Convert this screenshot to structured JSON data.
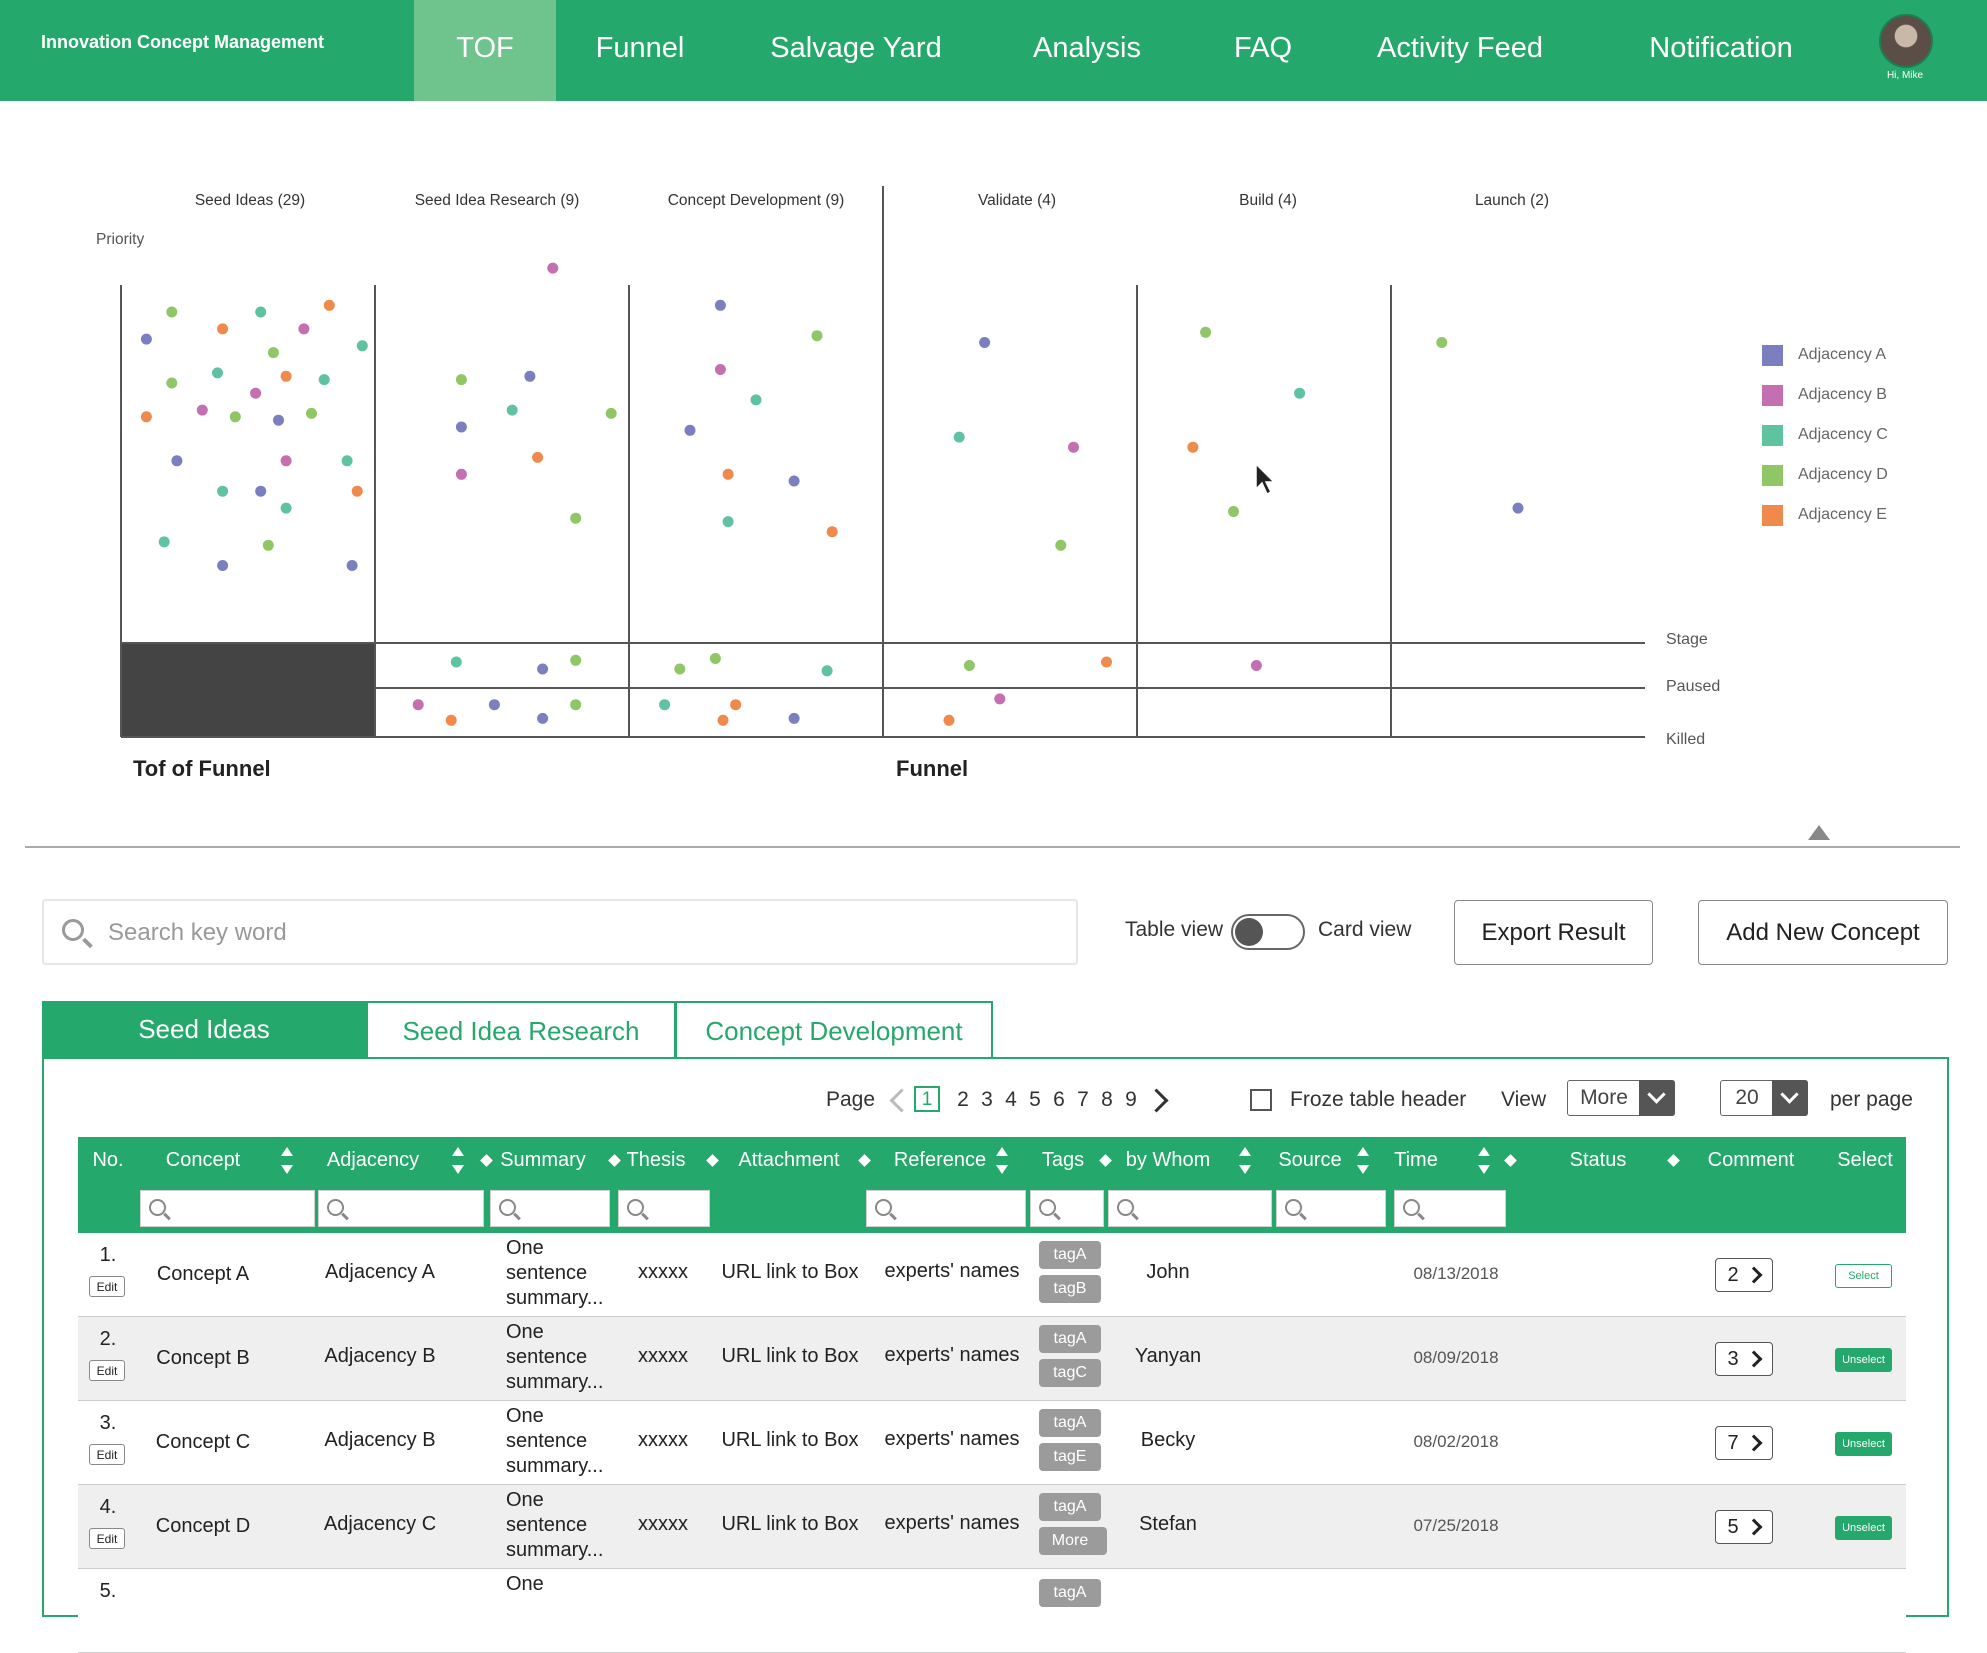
{
  "app": {
    "title": "Innovation Concept Management",
    "greeting": "Hi, Mike",
    "nav": [
      "TOF",
      "Funnel",
      "Salvage Yard",
      "Analysis",
      "FAQ",
      "Activity Feed",
      "Notification"
    ],
    "active_nav": "TOF"
  },
  "chart_data": {
    "type": "scatter",
    "y_axis_label": "Priority",
    "columns": [
      "Seed Ideas (29)",
      "Seed Idea Research (9)",
      "Concept Development (9)",
      "Validate (4)",
      "Build (4)",
      "Launch (2)"
    ],
    "row_labels": [
      "Stage",
      "Paused",
      "Killed"
    ],
    "section_labels": [
      "Tof of Funnel",
      "Funnel"
    ],
    "legend": [
      {
        "name": "Adjacency A",
        "color": "#7b7fbf"
      },
      {
        "name": "Adjacency B",
        "color": "#c46fb0"
      },
      {
        "name": "Adjacency C",
        "color": "#5fc3a0"
      },
      {
        "name": "Adjacency D",
        "color": "#8fc766"
      },
      {
        "name": "Adjacency E",
        "color": "#f0894c"
      }
    ],
    "points_note_units": "col = stage column index; pos = position within column 0-1; priority = 0 (low) to 1 (high); row = stage|paused|killed",
    "points": [
      {
        "col": 0,
        "pos": 0.2,
        "priority": 0.92,
        "adj": "D",
        "row": "stage"
      },
      {
        "col": 0,
        "pos": 0.55,
        "priority": 0.92,
        "adj": "C",
        "row": "stage"
      },
      {
        "col": 0,
        "pos": 0.82,
        "priority": 0.94,
        "adj": "E",
        "row": "stage"
      },
      {
        "col": 0,
        "pos": 0.1,
        "priority": 0.84,
        "adj": "A",
        "row": "stage"
      },
      {
        "col": 0,
        "pos": 0.4,
        "priority": 0.87,
        "adj": "E",
        "row": "stage"
      },
      {
        "col": 0,
        "pos": 0.72,
        "priority": 0.87,
        "adj": "B",
        "row": "stage"
      },
      {
        "col": 0,
        "pos": 0.95,
        "priority": 0.82,
        "adj": "C",
        "row": "stage"
      },
      {
        "col": 0,
        "pos": 0.6,
        "priority": 0.8,
        "adj": "D",
        "row": "stage"
      },
      {
        "col": 0,
        "pos": 0.2,
        "priority": 0.71,
        "adj": "D",
        "row": "stage"
      },
      {
        "col": 0,
        "pos": 0.38,
        "priority": 0.74,
        "adj": "C",
        "row": "stage"
      },
      {
        "col": 0,
        "pos": 0.65,
        "priority": 0.73,
        "adj": "E",
        "row": "stage"
      },
      {
        "col": 0,
        "pos": 0.8,
        "priority": 0.72,
        "adj": "C",
        "row": "stage"
      },
      {
        "col": 0,
        "pos": 0.53,
        "priority": 0.68,
        "adj": "B",
        "row": "stage"
      },
      {
        "col": 0,
        "pos": 0.1,
        "priority": 0.61,
        "adj": "E",
        "row": "stage"
      },
      {
        "col": 0,
        "pos": 0.32,
        "priority": 0.63,
        "adj": "B",
        "row": "stage"
      },
      {
        "col": 0,
        "pos": 0.45,
        "priority": 0.61,
        "adj": "D",
        "row": "stage"
      },
      {
        "col": 0,
        "pos": 0.62,
        "priority": 0.6,
        "adj": "A",
        "row": "stage"
      },
      {
        "col": 0,
        "pos": 0.75,
        "priority": 0.62,
        "adj": "D",
        "row": "stage"
      },
      {
        "col": 0,
        "pos": 0.22,
        "priority": 0.48,
        "adj": "A",
        "row": "stage"
      },
      {
        "col": 0,
        "pos": 0.65,
        "priority": 0.48,
        "adj": "B",
        "row": "stage"
      },
      {
        "col": 0,
        "pos": 0.89,
        "priority": 0.48,
        "adj": "C",
        "row": "stage"
      },
      {
        "col": 0,
        "pos": 0.4,
        "priority": 0.39,
        "adj": "C",
        "row": "stage"
      },
      {
        "col": 0,
        "pos": 0.55,
        "priority": 0.39,
        "adj": "A",
        "row": "stage"
      },
      {
        "col": 0,
        "pos": 0.93,
        "priority": 0.39,
        "adj": "E",
        "row": "stage"
      },
      {
        "col": 0,
        "pos": 0.65,
        "priority": 0.34,
        "adj": "C",
        "row": "stage"
      },
      {
        "col": 0,
        "pos": 0.17,
        "priority": 0.24,
        "adj": "C",
        "row": "stage"
      },
      {
        "col": 0,
        "pos": 0.58,
        "priority": 0.23,
        "adj": "D",
        "row": "stage"
      },
      {
        "col": 0,
        "pos": 0.4,
        "priority": 0.17,
        "adj": "A",
        "row": "stage"
      },
      {
        "col": 0,
        "pos": 0.91,
        "priority": 0.17,
        "adj": "A",
        "row": "stage"
      },
      {
        "col": 1,
        "pos": 0.7,
        "priority": 1.05,
        "adj": "B",
        "row": "stage"
      },
      {
        "col": 1,
        "pos": 0.34,
        "priority": 0.72,
        "adj": "D",
        "row": "stage"
      },
      {
        "col": 1,
        "pos": 0.61,
        "priority": 0.73,
        "adj": "A",
        "row": "stage"
      },
      {
        "col": 1,
        "pos": 0.54,
        "priority": 0.63,
        "adj": "C",
        "row": "stage"
      },
      {
        "col": 1,
        "pos": 0.93,
        "priority": 0.62,
        "adj": "D",
        "row": "stage"
      },
      {
        "col": 1,
        "pos": 0.34,
        "priority": 0.58,
        "adj": "A",
        "row": "stage"
      },
      {
        "col": 1,
        "pos": 0.64,
        "priority": 0.49,
        "adj": "E",
        "row": "stage"
      },
      {
        "col": 1,
        "pos": 0.34,
        "priority": 0.44,
        "adj": "B",
        "row": "stage"
      },
      {
        "col": 1,
        "pos": 0.79,
        "priority": 0.31,
        "adj": "D",
        "row": "stage"
      },
      {
        "col": 2,
        "pos": 0.36,
        "priority": 0.94,
        "adj": "A",
        "row": "stage"
      },
      {
        "col": 2,
        "pos": 0.74,
        "priority": 0.85,
        "adj": "D",
        "row": "stage"
      },
      {
        "col": 2,
        "pos": 0.36,
        "priority": 0.75,
        "adj": "B",
        "row": "stage"
      },
      {
        "col": 2,
        "pos": 0.5,
        "priority": 0.66,
        "adj": "C",
        "row": "stage"
      },
      {
        "col": 2,
        "pos": 0.24,
        "priority": 0.57,
        "adj": "A",
        "row": "stage"
      },
      {
        "col": 2,
        "pos": 0.39,
        "priority": 0.44,
        "adj": "E",
        "row": "stage"
      },
      {
        "col": 2,
        "pos": 0.65,
        "priority": 0.42,
        "adj": "A",
        "row": "stage"
      },
      {
        "col": 2,
        "pos": 0.39,
        "priority": 0.3,
        "adj": "C",
        "row": "stage"
      },
      {
        "col": 2,
        "pos": 0.8,
        "priority": 0.27,
        "adj": "E",
        "row": "stage"
      },
      {
        "col": 3,
        "pos": 0.4,
        "priority": 0.83,
        "adj": "A",
        "row": "stage"
      },
      {
        "col": 3,
        "pos": 0.3,
        "priority": 0.55,
        "adj": "C",
        "row": "stage"
      },
      {
        "col": 3,
        "pos": 0.75,
        "priority": 0.52,
        "adj": "B",
        "row": "stage"
      },
      {
        "col": 3,
        "pos": 0.7,
        "priority": 0.23,
        "adj": "D",
        "row": "stage"
      },
      {
        "col": 4,
        "pos": 0.27,
        "priority": 0.86,
        "adj": "D",
        "row": "stage"
      },
      {
        "col": 4,
        "pos": 0.64,
        "priority": 0.68,
        "adj": "C",
        "row": "stage"
      },
      {
        "col": 4,
        "pos": 0.22,
        "priority": 0.52,
        "adj": "E",
        "row": "stage"
      },
      {
        "col": 4,
        "pos": 0.38,
        "priority": 0.33,
        "adj": "D",
        "row": "stage"
      },
      {
        "col": 5,
        "pos": 0.2,
        "priority": 0.83,
        "adj": "D",
        "row": "stage"
      },
      {
        "col": 5,
        "pos": 0.5,
        "priority": 0.34,
        "adj": "A",
        "row": "stage"
      },
      {
        "col": 1,
        "pos": 0.32,
        "priority": 0.6,
        "adj": "C",
        "row": "paused"
      },
      {
        "col": 1,
        "pos": 0.66,
        "priority": 0.4,
        "adj": "A",
        "row": "paused"
      },
      {
        "col": 1,
        "pos": 0.79,
        "priority": 0.65,
        "adj": "D",
        "row": "paused"
      },
      {
        "col": 2,
        "pos": 0.2,
        "priority": 0.4,
        "adj": "D",
        "row": "paused"
      },
      {
        "col": 2,
        "pos": 0.34,
        "priority": 0.7,
        "adj": "D",
        "row": "paused"
      },
      {
        "col": 2,
        "pos": 0.78,
        "priority": 0.35,
        "adj": "C",
        "row": "paused"
      },
      {
        "col": 3,
        "pos": 0.34,
        "priority": 0.5,
        "adj": "D",
        "row": "paused"
      },
      {
        "col": 3,
        "pos": 0.88,
        "priority": 0.6,
        "adj": "E",
        "row": "paused"
      },
      {
        "col": 4,
        "pos": 0.47,
        "priority": 0.5,
        "adj": "B",
        "row": "paused"
      },
      {
        "col": 1,
        "pos": 0.17,
        "priority": 0.7,
        "adj": "B",
        "row": "killed"
      },
      {
        "col": 1,
        "pos": 0.3,
        "priority": 0.3,
        "adj": "E",
        "row": "killed"
      },
      {
        "col": 1,
        "pos": 0.47,
        "priority": 0.7,
        "adj": "A",
        "row": "killed"
      },
      {
        "col": 1,
        "pos": 0.66,
        "priority": 0.35,
        "adj": "A",
        "row": "killed"
      },
      {
        "col": 1,
        "pos": 0.79,
        "priority": 0.7,
        "adj": "D",
        "row": "killed"
      },
      {
        "col": 2,
        "pos": 0.14,
        "priority": 0.7,
        "adj": "C",
        "row": "killed"
      },
      {
        "col": 2,
        "pos": 0.42,
        "priority": 0.7,
        "adj": "E",
        "row": "killed"
      },
      {
        "col": 2,
        "pos": 0.37,
        "priority": 0.3,
        "adj": "E",
        "row": "killed"
      },
      {
        "col": 2,
        "pos": 0.65,
        "priority": 0.35,
        "adj": "A",
        "row": "killed"
      },
      {
        "col": 3,
        "pos": 0.46,
        "priority": 0.85,
        "adj": "B",
        "row": "killed"
      },
      {
        "col": 3,
        "pos": 0.26,
        "priority": 0.3,
        "adj": "E",
        "row": "killed"
      }
    ]
  },
  "toolbar": {
    "search_placeholder": "Search key word",
    "table_view_label": "Table view",
    "card_view_label": "Card view",
    "export_label": "Export Result",
    "add_label": "Add New Concept"
  },
  "tabs": [
    "Seed Ideas",
    "Seed Idea Research",
    "Concept Development"
  ],
  "pager": {
    "page_label": "Page",
    "pages": [
      "1",
      "2",
      "3",
      "4",
      "5",
      "6",
      "7",
      "8",
      "9"
    ],
    "current": "1",
    "froze_label": "Froze table header",
    "view_label": "View",
    "view_value": "More",
    "per_page_value": "20",
    "per_page_label": "per page"
  },
  "table": {
    "columns": [
      "No.",
      "Concept",
      "Adjacency",
      "Summary",
      "Thesis",
      "Attachment",
      "Reference",
      "Tags",
      "by Whom",
      "Source",
      "Time",
      "Status",
      "Comment",
      "Select"
    ],
    "sort_a": "A",
    "sort_z": "Z",
    "edit_label": "Edit",
    "rows": [
      {
        "no": "1.",
        "concept": "Concept A",
        "adjacency": "Adjacency A",
        "summary": "One sentence summary...",
        "thesis": "xxxxx",
        "attachment": "URL link to Box",
        "reference": "experts' names",
        "tag1": "tagA",
        "tag2": "tagB",
        "who": "John",
        "time": "08/13/2018",
        "comment": "2",
        "select": "Select"
      },
      {
        "no": "2.",
        "concept": "Concept B",
        "adjacency": "Adjacency B",
        "summary": "One sentence summary...",
        "thesis": "xxxxx",
        "attachment": "URL link to Box",
        "reference": "experts' names",
        "tag1": "tagA",
        "tag2": "tagC",
        "who": "Yanyan",
        "time": "08/09/2018",
        "comment": "3",
        "select": "Unselect"
      },
      {
        "no": "3.",
        "concept": "Concept C",
        "adjacency": "Adjacency B",
        "summary": "One sentence summary...",
        "thesis": "xxxxx",
        "attachment": "URL link to Box",
        "reference": "experts' names",
        "tag1": "tagA",
        "tag2": "tagE",
        "who": "Becky",
        "time": "08/02/2018",
        "comment": "7",
        "select": "Unselect"
      },
      {
        "no": "4.",
        "concept": "Concept D",
        "adjacency": "Adjacency C",
        "summary": "One sentence summary...",
        "thesis": "xxxxx",
        "attachment": "URL link to Box",
        "reference": "experts' names",
        "tag1": "tagA",
        "tag2": "More",
        "who": "Stefan",
        "time": "07/25/2018",
        "comment": "5",
        "select": "Unselect"
      },
      {
        "no": "5.",
        "summary": "One",
        "tag1": "tagA"
      }
    ]
  }
}
